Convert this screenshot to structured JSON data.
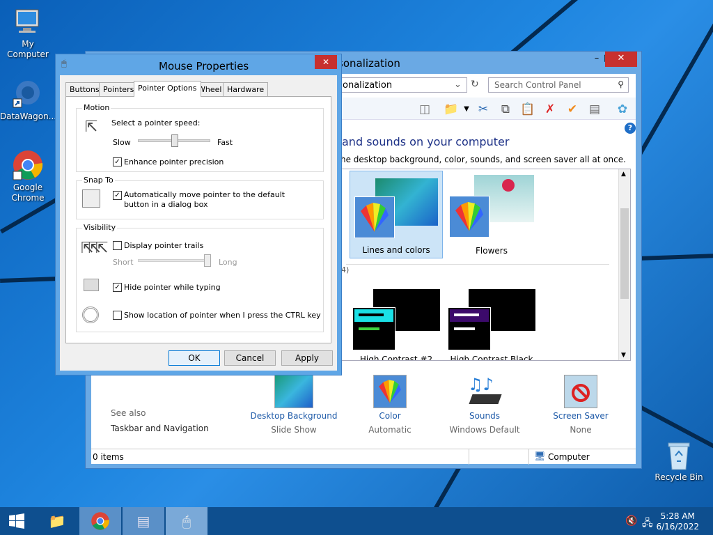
{
  "desktop": {
    "icons": [
      {
        "label": "My Computer"
      },
      {
        "label": "DataWagon..."
      },
      {
        "label": "Google Chrome"
      },
      {
        "label": "Recycle Bin"
      }
    ]
  },
  "control_panel": {
    "title": "sonalization",
    "address": "onalization",
    "search_placeholder": "Search Control Panel",
    "heading": "and sounds on your computer",
    "subheading": "he desktop background, color, sounds, and screen saver all at once.",
    "themes": [
      {
        "name": "Lines and colors"
      },
      {
        "name": "Flowers"
      },
      {
        "name": "High Contrast #2"
      },
      {
        "name": "High Contrast Black"
      }
    ],
    "group_count": "4)",
    "bottom_items": [
      {
        "label": "Desktop Background",
        "sub": "Slide Show"
      },
      {
        "label": "Color",
        "sub": "Automatic"
      },
      {
        "label": "Sounds",
        "sub": "Windows Default"
      },
      {
        "label": "Screen Saver",
        "sub": "None"
      }
    ],
    "see_also": "See also",
    "taskbar_nav": "Taskbar and Navigation",
    "status_items": "0 items",
    "status_location": "Computer"
  },
  "mouse_properties": {
    "title": "Mouse Properties",
    "tabs": [
      "Buttons",
      "Pointers",
      "Pointer Options",
      "Wheel",
      "Hardware"
    ],
    "motion": {
      "label": "Motion",
      "speed_label": "Select a pointer speed:",
      "slow": "Slow",
      "fast": "Fast",
      "speed_value": 0.5,
      "enhance": "Enhance pointer precision",
      "enhance_checked": true
    },
    "snap_to": {
      "label": "Snap To",
      "text": "Automatically move pointer to the default button in a dialog box",
      "checked": true
    },
    "visibility": {
      "label": "Visibility",
      "trails": "Display pointer trails",
      "trails_checked": false,
      "short": "Short",
      "long": "Long",
      "trail_value": 1.0,
      "hide": "Hide pointer while typing",
      "hide_checked": true,
      "ctrl": "Show location of pointer when I press the CTRL key",
      "ctrl_checked": false
    },
    "buttons": {
      "ok": "OK",
      "cancel": "Cancel",
      "apply": "Apply"
    }
  },
  "taskbar": {
    "time": "5:28 AM",
    "date": "6/16/2022"
  }
}
